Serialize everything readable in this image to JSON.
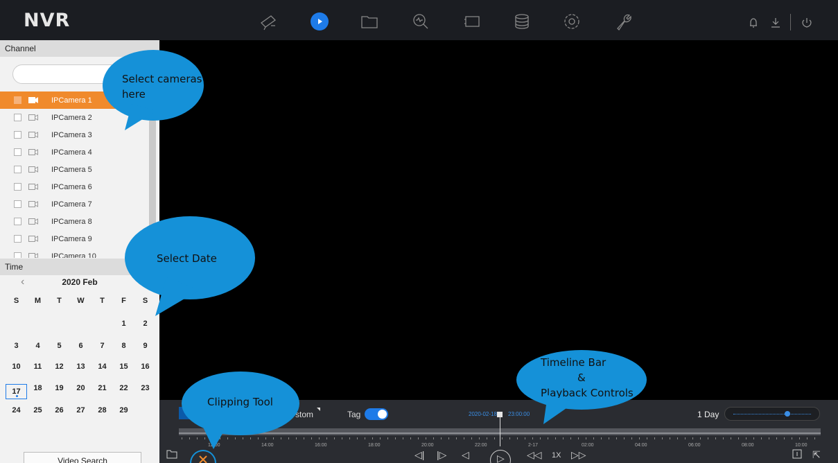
{
  "app": {
    "logo": "NVR"
  },
  "nav": {
    "icons": [
      "camera-icon",
      "playback-icon",
      "folder-icon",
      "search-analytics-icon",
      "screen-icon",
      "database-icon",
      "gear-icon",
      "wrench-icon"
    ],
    "active": "playback-icon",
    "accent": "#1e7be8"
  },
  "channel": {
    "header": "Channel",
    "items": [
      {
        "label": "IPCamera 1",
        "selected": true
      },
      {
        "label": "IPCamera 2",
        "selected": false
      },
      {
        "label": "IPCamera 3",
        "selected": false
      },
      {
        "label": "IPCamera 4",
        "selected": false
      },
      {
        "label": "IPCamera 5",
        "selected": false
      },
      {
        "label": "IPCamera 6",
        "selected": false
      },
      {
        "label": "IPCamera 7",
        "selected": false
      },
      {
        "label": "IPCamera 8",
        "selected": false
      },
      {
        "label": "IPCamera 9",
        "selected": false
      },
      {
        "label": "IPCamera 10",
        "selected": false
      }
    ],
    "selected_color": "#f08a2c"
  },
  "time": {
    "header": "Time",
    "month_title": "2020 Feb",
    "weekdays": [
      "S",
      "M",
      "T",
      "W",
      "T",
      "F",
      "S"
    ],
    "weeks": [
      [
        "",
        "",
        "",
        "",
        "",
        "1",
        "2"
      ],
      [
        "3",
        "4",
        "5",
        "6",
        "7",
        "8",
        "9"
      ],
      [
        "10",
        "11",
        "12",
        "13",
        "14",
        "15",
        "16"
      ],
      [
        "17",
        "18",
        "19",
        "20",
        "21",
        "22",
        "23"
      ],
      [
        "24",
        "25",
        "26",
        "27",
        "28",
        "29",
        ""
      ]
    ],
    "selected_day": "17"
  },
  "search_button": "Video Search",
  "controls": {
    "custom_label": "stom",
    "tag_label": "Tag",
    "tag_on": true,
    "timestamp_date": "2020-02-18",
    "timestamp_time": "23:00:00",
    "range_label": "1 Day",
    "ticks": [
      "12:00",
      "14:00",
      "16:00",
      "18:00",
      "20:00",
      "22:00",
      "2-17",
      "02:00",
      "04:00",
      "06:00",
      "08:00",
      "10:00"
    ],
    "speed": "1X"
  },
  "callouts": {
    "cameras": [
      "Select cameras",
      "here"
    ],
    "date": "Select Date",
    "timeline": [
      "Timeline Bar",
      "&",
      "Playback Controls"
    ],
    "clip": "Clipping Tool"
  }
}
